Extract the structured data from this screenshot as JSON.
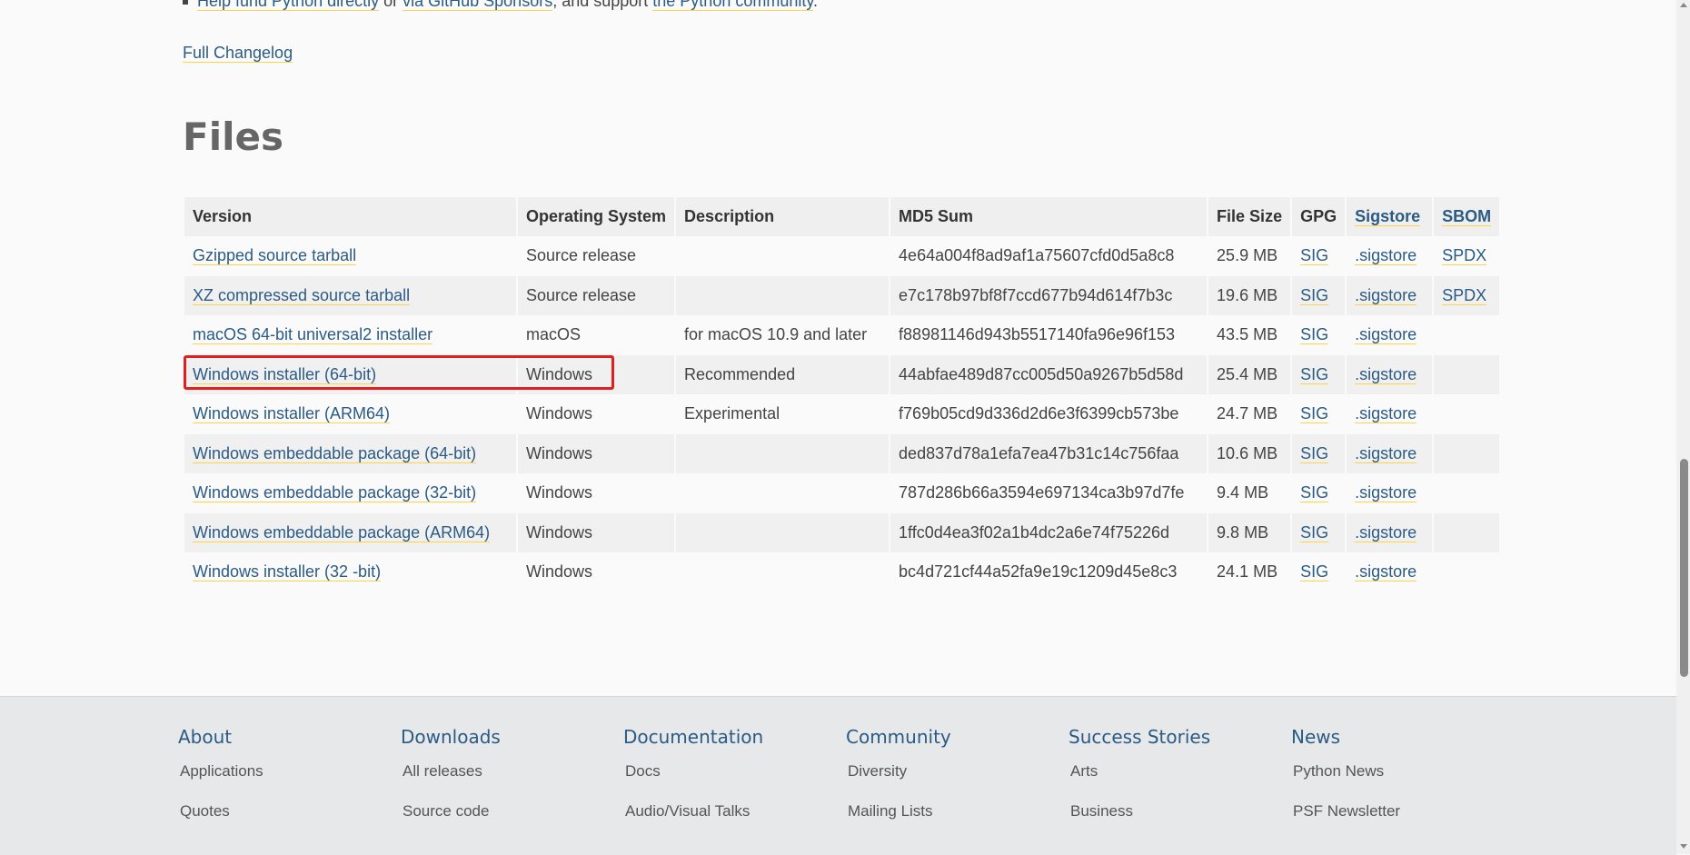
{
  "support_line": {
    "link1": "Help fund Python directly",
    "text1": " or ",
    "link2": "via GitHub Sponsors",
    "text2": ", and support ",
    "link3": "the Python community",
    "text3": "."
  },
  "changelog_link": "Full Changelog",
  "files_title": "Files",
  "table": {
    "headers": [
      "Version",
      "Operating System",
      "Description",
      "MD5 Sum",
      "File Size",
      "GPG",
      "Sigstore",
      "SBOM"
    ],
    "rows": [
      {
        "version": "Gzipped source tarball",
        "os": "Source release",
        "description": "",
        "md5": "4e64a004f8ad9af1a75607cfd0d5a8c8",
        "size": "25.9 MB",
        "gpg": "SIG",
        "sigstore": ".sigstore",
        "sbom": "SPDX"
      },
      {
        "version": "XZ compressed source tarball",
        "os": "Source release",
        "description": "",
        "md5": "e7c178b97bf8f7ccd677b94d614f7b3c",
        "size": "19.6 MB",
        "gpg": "SIG",
        "sigstore": ".sigstore",
        "sbom": "SPDX"
      },
      {
        "version": "macOS 64-bit universal2 installer",
        "os": "macOS",
        "description": "for macOS 10.9 and later",
        "md5": "f88981146d943b5517140fa96e96f153",
        "size": "43.5 MB",
        "gpg": "SIG",
        "sigstore": ".sigstore",
        "sbom": ""
      },
      {
        "version": "Windows installer (64-bit)",
        "os": "Windows",
        "description": "Recommended",
        "md5": "44abfae489d87cc005d50a9267b5d58d",
        "size": "25.4 MB",
        "gpg": "SIG",
        "sigstore": ".sigstore",
        "sbom": ""
      },
      {
        "version": "Windows installer (ARM64)",
        "os": "Windows",
        "description": "Experimental",
        "md5": "f769b05cd9d336d2d6e3f6399cb573be",
        "size": "24.7 MB",
        "gpg": "SIG",
        "sigstore": ".sigstore",
        "sbom": ""
      },
      {
        "version": "Windows embeddable package (64-bit)",
        "os": "Windows",
        "description": "",
        "md5": "ded837d78a1efa7ea47b31c14c756faa",
        "size": "10.6 MB",
        "gpg": "SIG",
        "sigstore": ".sigstore",
        "sbom": ""
      },
      {
        "version": "Windows embeddable package (32-bit)",
        "os": "Windows",
        "description": "",
        "md5": "787d286b66a3594e697134ca3b97d7fe",
        "size": "9.4 MB",
        "gpg": "SIG",
        "sigstore": ".sigstore",
        "sbom": ""
      },
      {
        "version": "Windows embeddable package (ARM64)",
        "os": "Windows",
        "description": "",
        "md5": "1ffc0d4ea3f02a1b4dc2a6e74f75226d",
        "size": "9.8 MB",
        "gpg": "SIG",
        "sigstore": ".sigstore",
        "sbom": ""
      },
      {
        "version": "Windows installer (32 -bit)",
        "os": "Windows",
        "description": "",
        "md5": "bc4d721cf44a52fa9e19c1209d45e8c3",
        "size": "24.1 MB",
        "gpg": "SIG",
        "sigstore": ".sigstore",
        "sbom": ""
      }
    ]
  },
  "footer": {
    "columns": [
      {
        "heading": "About",
        "links": [
          "Applications",
          "Quotes"
        ]
      },
      {
        "heading": "Downloads",
        "links": [
          "All releases",
          "Source code"
        ]
      },
      {
        "heading": "Documentation",
        "links": [
          "Docs",
          "Audio/Visual Talks"
        ]
      },
      {
        "heading": "Community",
        "links": [
          "Diversity",
          "Mailing Lists"
        ]
      },
      {
        "heading": "Success Stories",
        "links": [
          "Arts",
          "Business"
        ]
      },
      {
        "heading": "News",
        "links": [
          "Python News",
          "PSF Newsletter"
        ]
      }
    ]
  },
  "colors": {
    "link": "#2b5b84",
    "link_underline": "#ffd343",
    "highlight_box": "#e02020",
    "footer_bg": "#e6e8ea"
  }
}
